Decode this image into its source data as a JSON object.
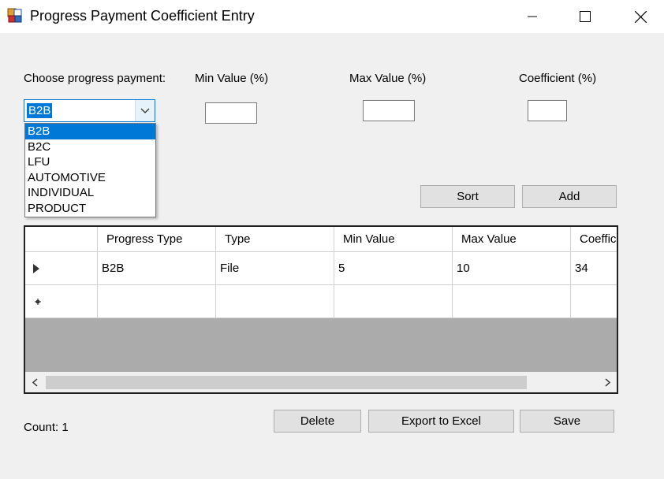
{
  "window": {
    "title": "Progress Payment Coefficient Entry",
    "icon": "app-form-icon",
    "controls": {
      "minimize": "minimize-icon",
      "maximize": "maximize-icon",
      "close": "close-icon"
    }
  },
  "form": {
    "progress_payment_label": "Choose progress payment:",
    "min_value_label": "Min Value (%)",
    "max_value_label": "Max Value (%)",
    "coefficient_label": "Coefficient (%)",
    "min_value": "",
    "max_value": "",
    "coefficient": "",
    "combo": {
      "selected": "B2B",
      "options": [
        "B2B",
        "B2C",
        "LFU",
        "AUTOMOTIVE",
        "INDIVIDUAL",
        "PRODUCT"
      ],
      "highlighted_index": 0
    }
  },
  "buttons": {
    "sort": "Sort",
    "add": "Add",
    "delete": "Delete",
    "export": "Export to Excel",
    "save": "Save"
  },
  "grid": {
    "columns": [
      "",
      "Progress Type",
      "Type",
      "Min Value",
      "Max Value",
      "Coeffic"
    ],
    "rows": [
      {
        "indicator": "current-row-icon",
        "cells": [
          "B2B",
          "File",
          "5",
          "10",
          "34"
        ]
      }
    ],
    "new_row_indicator": "new-row-icon"
  },
  "status": {
    "count": "Count: 1"
  },
  "colors": {
    "selection": "#0078d7",
    "window_bg": "#f0f0f0",
    "grid_bg": "#ababab",
    "button_bg": "#e1e1e1"
  }
}
